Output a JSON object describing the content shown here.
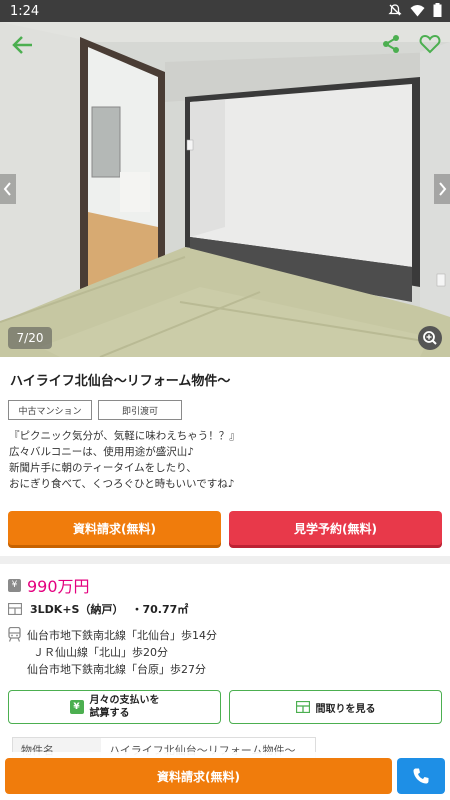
{
  "status_bar": {
    "time": "1:24",
    "icons": [
      "mute-icon",
      "wifi-icon",
      "battery-icon"
    ]
  },
  "gallery": {
    "counter": "7/20",
    "icons": [
      "back-arrow-icon",
      "share-icon",
      "favorite-heart-icon",
      "prev-chevron-icon",
      "next-chevron-icon",
      "zoom-icon"
    ]
  },
  "property": {
    "title": "ハイライフ北仙台～リフォーム物件～",
    "tags": [
      "中古マンション",
      "即引渡可"
    ],
    "description": [
      "『ピクニック気分が、気軽に味わえちゃう！？』",
      "広々バルコニーは、使用用途が盛沢山♪",
      "新聞片手に朝のティータイムをしたり、",
      "おにぎり食べて、くつろぐひと時もいいですね♪"
    ]
  },
  "actions": {
    "request_docs": "資料請求(無料)",
    "visit_reservation": "見学予約(無料)"
  },
  "details": {
    "yen_symbol": "¥",
    "price": "990万円",
    "layout": "3LDK+S（納戸）",
    "area": "・70.77㎡",
    "access": [
      "仙台市地下鉄南北線「北仙台」歩14分",
      "ＪＲ仙山線「北山」歩20分",
      "仙台市地下鉄南北線「台原」歩27分"
    ]
  },
  "secondary_actions": {
    "monthly_payment_line1": "月々の支払いを",
    "monthly_payment_line2": "試算する",
    "floor_plan": "間取りを見る"
  },
  "table": {
    "label": "物件名",
    "value": "ハイライフ北仙台～リフォーム物件～"
  },
  "bottom_bar": {
    "request_docs": "資料請求(無料)"
  },
  "colors": {
    "accent_green": "#4caf50",
    "orange": "#f07c0c",
    "red": "#e8394a",
    "price_pink": "#e4007f",
    "call_blue": "#1e8fe6"
  }
}
